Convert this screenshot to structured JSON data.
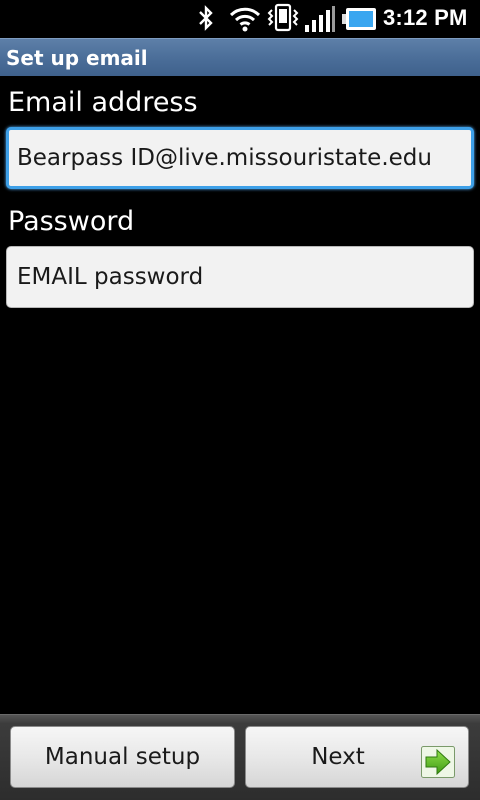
{
  "status_bar": {
    "time": "3:12 PM",
    "icons": [
      "bluetooth-icon",
      "wifi-icon",
      "vibrate-icon",
      "signal-icon",
      "battery-icon"
    ],
    "accent_color": "#3aa6f0"
  },
  "title_bar": {
    "title": "Set up email",
    "color": "#4a6d98"
  },
  "form": {
    "email_label": "Email address",
    "email_value": "Bearpass ID@live.missouristate.edu",
    "password_label": "Password",
    "password_value": "EMAIL password",
    "focus_color": "#3ea0e8"
  },
  "buttons": {
    "manual_setup": "Manual setup",
    "next": "Next",
    "next_icon": "green-arrow-right-icon",
    "next_icon_color": "#4fb81e"
  }
}
